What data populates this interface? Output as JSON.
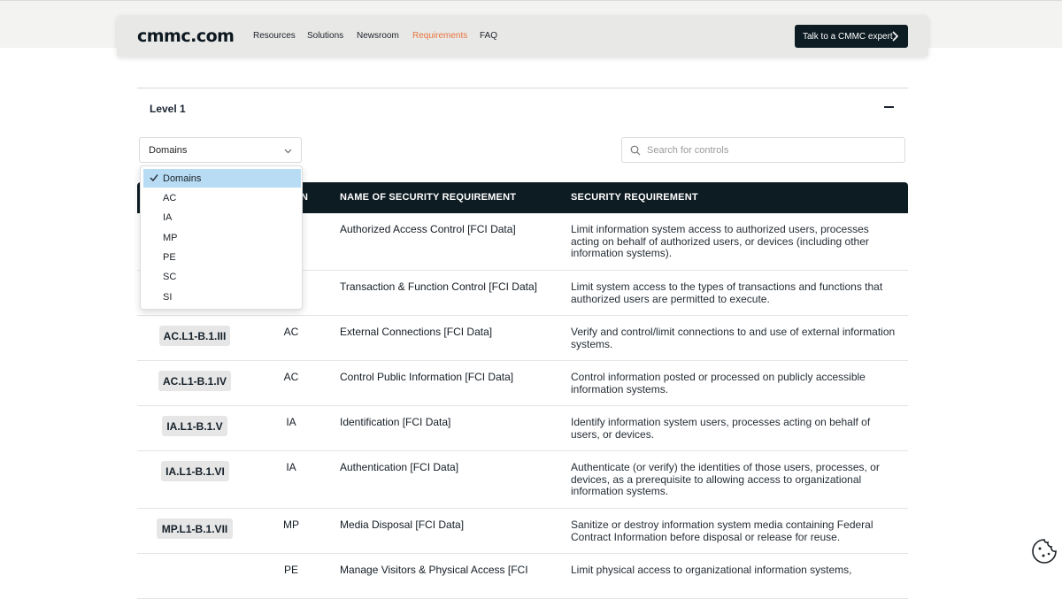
{
  "nav": {
    "logo": "cmmc.com",
    "links": [
      {
        "label": "Resources",
        "active": false
      },
      {
        "label": "Solutions",
        "active": false
      },
      {
        "label": "Newsroom",
        "active": false
      },
      {
        "label": "Requirements",
        "active": true
      },
      {
        "label": "FAQ",
        "active": false
      }
    ],
    "cta": "Talk to a CMMC expert"
  },
  "accordion": {
    "title": "Level 1"
  },
  "filter": {
    "selected": "Domains",
    "options": [
      "Domains",
      "AC",
      "IA",
      "MP",
      "PE",
      "SC",
      "SI"
    ]
  },
  "search": {
    "placeholder": "Search for controls"
  },
  "table": {
    "headers": [
      "N",
      "NAME OF SECURITY REQUIREMENT",
      "SECURITY REQUIREMENT"
    ],
    "rows": [
      {
        "id": "",
        "domain": "",
        "name": "Authorized Access Control [FCI Data]",
        "requirement": "Limit information system access to authorized users, processes acting on behalf of authorized users, or devices (including other information systems)."
      },
      {
        "id": "",
        "domain": "",
        "name": "Transaction & Function Control [FCI Data]",
        "requirement": "Limit system access to the types of transactions and functions that authorized users are permitted to execute."
      },
      {
        "id": "AC.L1-B.1.III",
        "domain": "AC",
        "name": "External Connections [FCI Data]",
        "requirement": "Verify and control/limit connections to and use of external information systems."
      },
      {
        "id": "AC.L1-B.1.IV",
        "domain": "AC",
        "name": "Control Public Information [FCI Data]",
        "requirement": "Control information posted or processed on publicly accessible information systems."
      },
      {
        "id": "IA.L1-B.1.V",
        "domain": "IA",
        "name": "Identification [FCI Data]",
        "requirement": "Identify information system users, processes acting on behalf of users, or devices."
      },
      {
        "id": "IA.L1-B.1.VI",
        "domain": "IA",
        "name": "Authentication [FCI Data]",
        "requirement": "Authenticate (or verify) the identities of those users, processes, or devices, as a prerequisite to allowing access to organizational information systems."
      },
      {
        "id": "MP.L1-B.1.VII",
        "domain": "MP",
        "name": "Media Disposal [FCI Data]",
        "requirement": "Sanitize or destroy information system media containing Federal Contract Information before disposal or release for reuse."
      },
      {
        "id": "",
        "domain": "PE",
        "name": "Manage Visitors & Physical Access [FCI",
        "requirement": "Limit physical access to organizational information systems,"
      }
    ]
  }
}
